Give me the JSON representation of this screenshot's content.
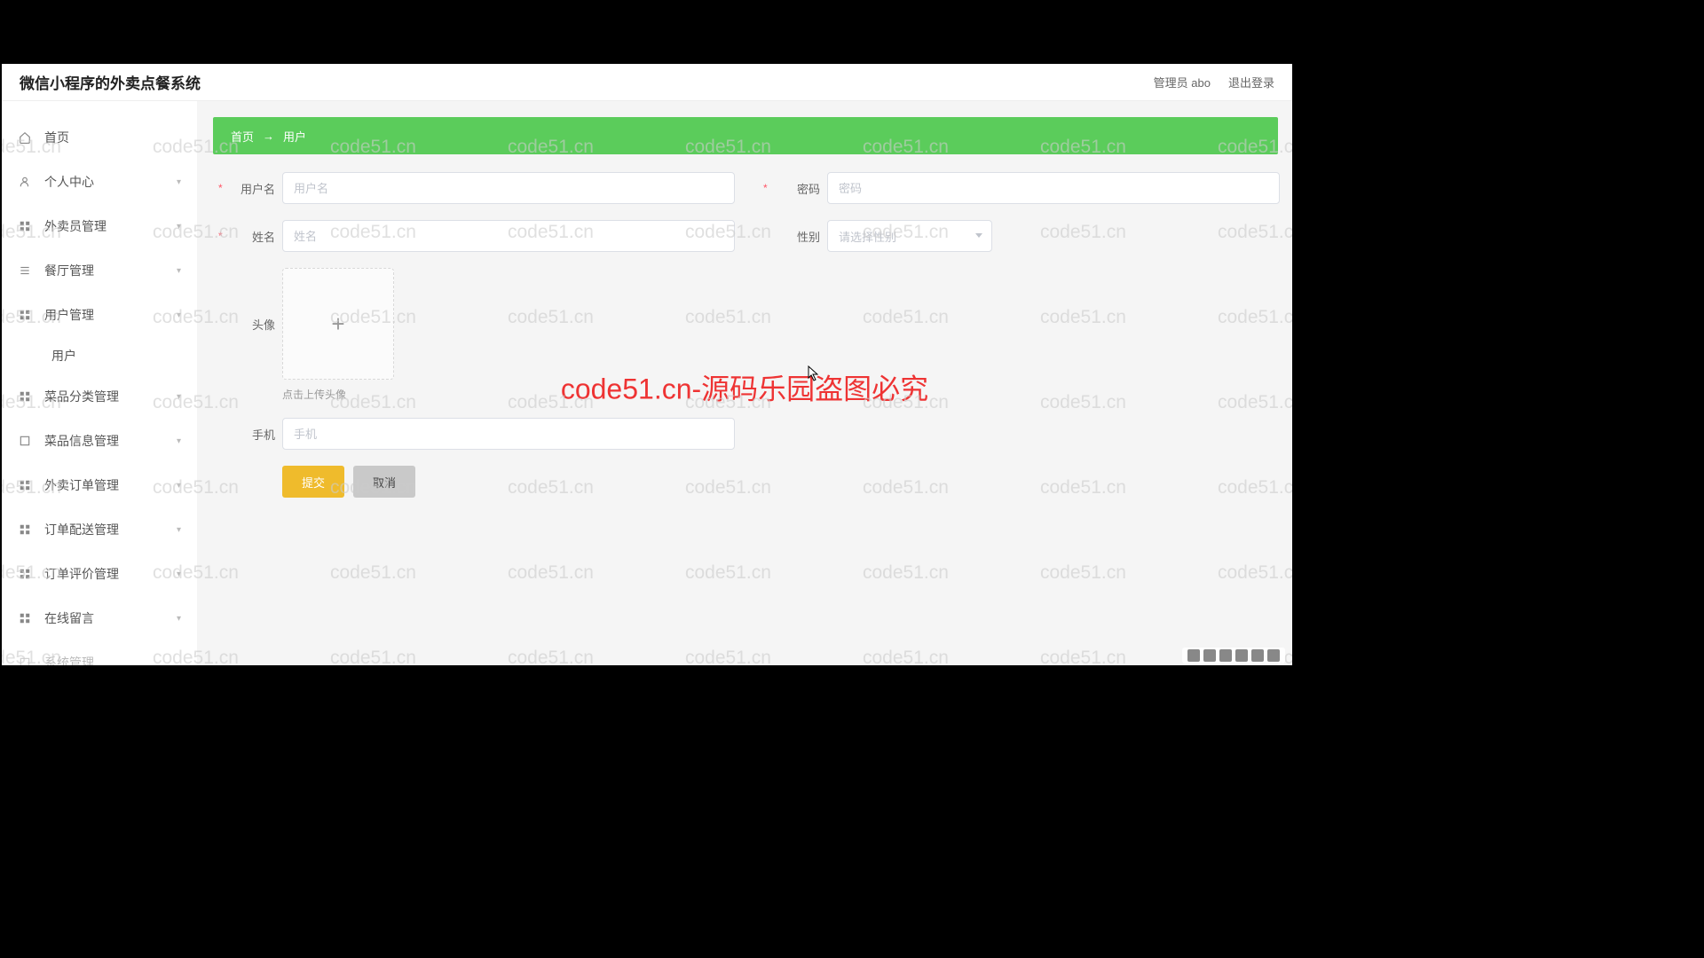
{
  "header": {
    "title": "微信小程序的外卖点餐系统",
    "admin_label": "管理员 abo",
    "logout_label": "退出登录"
  },
  "sidebar": {
    "items": [
      {
        "label": "首页",
        "icon": "home",
        "expandable": false
      },
      {
        "label": "个人中心",
        "icon": "user",
        "expandable": true
      },
      {
        "label": "外卖员管理",
        "icon": "grid",
        "expandable": true
      },
      {
        "label": "餐厅管理",
        "icon": "list",
        "expandable": true
      },
      {
        "label": "用户管理",
        "icon": "grid",
        "expandable": true,
        "expanded": true,
        "children": [
          "用户"
        ]
      },
      {
        "label": "菜品分类管理",
        "icon": "grid",
        "expandable": true
      },
      {
        "label": "菜品信息管理",
        "icon": "square",
        "expandable": true
      },
      {
        "label": "外卖订单管理",
        "icon": "grid",
        "expandable": true
      },
      {
        "label": "订单配送管理",
        "icon": "grid",
        "expandable": true
      },
      {
        "label": "订单评价管理",
        "icon": "grid",
        "expandable": true
      },
      {
        "label": "在线留言",
        "icon": "grid",
        "expandable": true
      },
      {
        "label": "系统管理",
        "icon": "square",
        "expandable": true
      }
    ]
  },
  "breadcrumb": {
    "home": "首页",
    "current": "用户"
  },
  "form": {
    "username": {
      "label": "用户名",
      "placeholder": "用户名"
    },
    "password": {
      "label": "密码",
      "placeholder": "密码"
    },
    "name": {
      "label": "姓名",
      "placeholder": "姓名"
    },
    "gender": {
      "label": "性别",
      "placeholder": "请选择性别"
    },
    "avatar": {
      "label": "头像",
      "hint": "点击上传头像"
    },
    "phone": {
      "label": "手机",
      "placeholder": "手机"
    },
    "submit": "提交",
    "cancel": "取消"
  },
  "watermark": {
    "text": "code51.cn",
    "center": "code51.cn-源码乐园盗图必究"
  }
}
